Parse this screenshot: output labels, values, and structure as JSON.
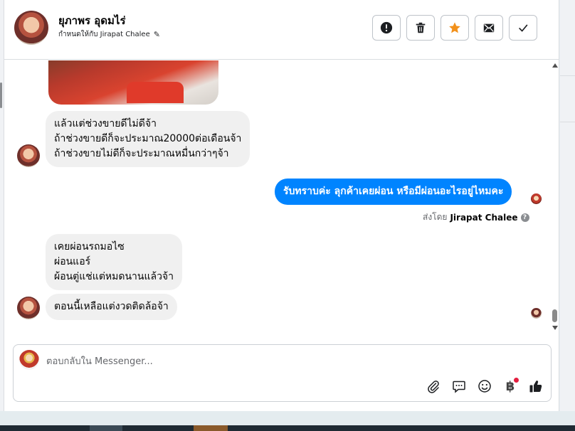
{
  "header": {
    "contact_name": "ยุภาพร อุดมไร่",
    "assigned_to": "กำหนดให้กับ Jirapat Chalee",
    "actions": [
      {
        "name": "report-button",
        "icon": "alert-icon"
      },
      {
        "name": "delete-button",
        "icon": "trash-icon"
      },
      {
        "name": "star-button",
        "icon": "star-icon",
        "color": "#f2911b"
      },
      {
        "name": "mark-unread-button",
        "icon": "envelope-icon"
      },
      {
        "name": "done-button",
        "icon": "check-icon"
      }
    ]
  },
  "messages": {
    "incoming_1": {
      "lines": [
        "แล้วแต่ช่วงขายดีไม่ดีจ้า",
        "ถ้าช่วงขายดีก็จะประมาณ20000ต่อเดือนจ้า",
        "ถ้าช่วงขายไม่ดีก็จะประมาณหมื่นกว่าๆจ้า"
      ]
    },
    "outgoing_1": {
      "text": "รับทราบค่ะ ลุกค้าเคยผ่อน หรือมีผ่อนอะไรอยู่ไหมคะ",
      "sent_by_label": "ส่งโดย",
      "sent_by_name": "Jirapat Chalee",
      "info": "?"
    },
    "incoming_2": {
      "lines": [
        "เคยผ่อนรถมอไซ",
        "ผ่อนแอร์",
        "ผ้อนตู่แช่แต่หมดนานแล้วจ้า"
      ]
    },
    "incoming_3": {
      "text": "ตอนนี้เหลือแต่งวดติดล้อจ้า"
    }
  },
  "composer": {
    "placeholder": "ตอบกลับใน Messenger...",
    "tools": [
      "attach-icon",
      "saved-reply-icon",
      "emoji-icon",
      "payment-icon",
      "like-icon"
    ],
    "baht_symbol": "฿",
    "accent_color": "#0084ff"
  }
}
